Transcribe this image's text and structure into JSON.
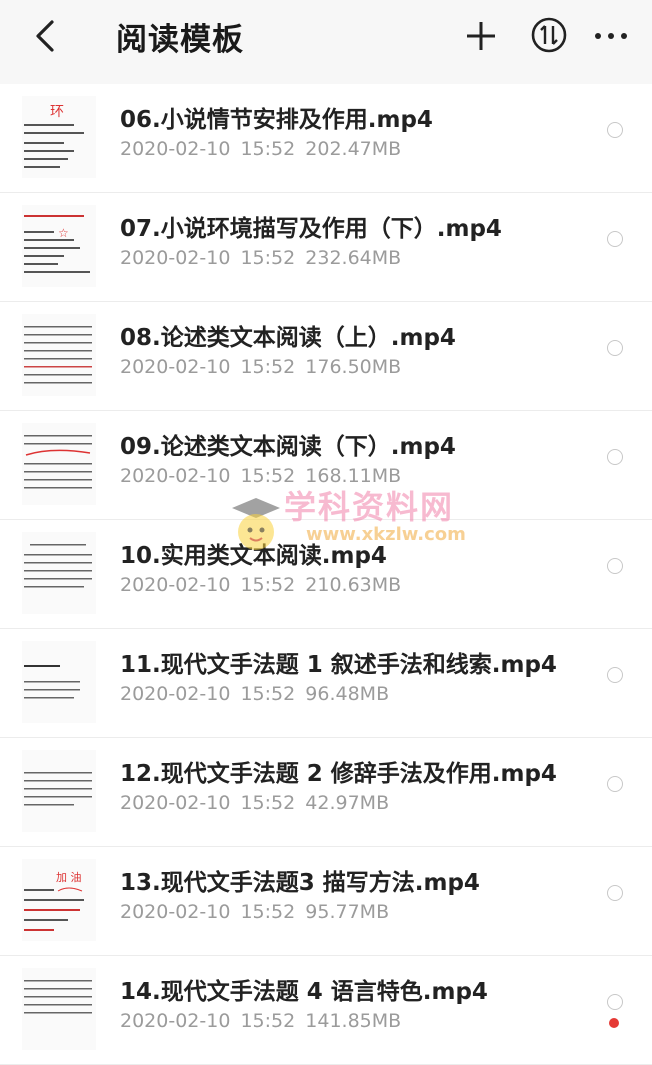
{
  "header": {
    "title": "阅读模板",
    "icons": [
      "back-icon",
      "add-icon",
      "sort-icon",
      "more-icon"
    ]
  },
  "files": [
    {
      "name": "06.小说情节安排及作用.mp4",
      "date": "2020-02-10",
      "time": "15:52",
      "size": "202.47MB"
    },
    {
      "name": "07.小说环境描写及作用（下）.mp4",
      "date": "2020-02-10",
      "time": "15:52",
      "size": "232.64MB"
    },
    {
      "name": "08.论述类文本阅读（上）.mp4",
      "date": "2020-02-10",
      "time": "15:52",
      "size": "176.50MB"
    },
    {
      "name": "09.论述类文本阅读（下）.mp4",
      "date": "2020-02-10",
      "time": "15:52",
      "size": "168.11MB"
    },
    {
      "name": "10.实用类文本阅读.mp4",
      "date": "2020-02-10",
      "time": "15:52",
      "size": "210.63MB"
    },
    {
      "name": "11.现代文手法题 1 叙述手法和线索.mp4",
      "date": "2020-02-10",
      "time": "15:52",
      "size": "96.48MB"
    },
    {
      "name": "12.现代文手法题 2 修辞手法及作用.mp4",
      "date": "2020-02-10",
      "time": "15:52",
      "size": "42.97MB"
    },
    {
      "name": "13.现代文手法题3 描写方法.mp4",
      "date": "2020-02-10",
      "time": "15:52",
      "size": "95.77MB"
    },
    {
      "name": "14.现代文手法题 4 语言特色.mp4",
      "date": "2020-02-10",
      "time": "15:52",
      "size": "141.85MB"
    }
  ],
  "watermark": {
    "text": "学科资料网",
    "url": "www.xkzlw.com"
  },
  "colors": {
    "header_bg": "#f7f7f7",
    "title": "#1a1a1a",
    "meta": "#9b9b9b",
    "radio_border": "#c8c8c8",
    "accent_dot": "#e53935"
  }
}
